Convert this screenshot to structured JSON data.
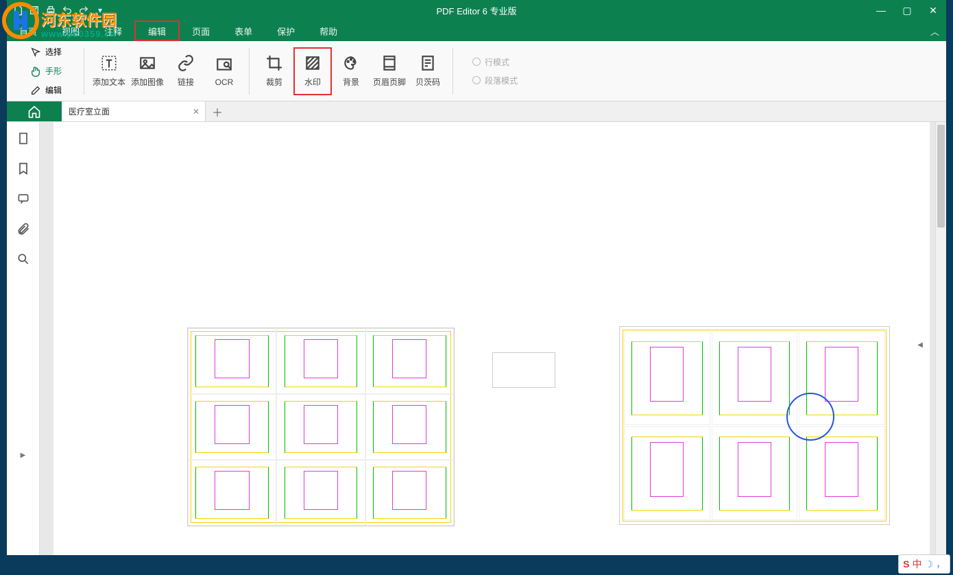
{
  "app_title": "PDF Editor 6 专业版",
  "watermark": {
    "brand": "河东软件园",
    "url": "www.pc0359.cn"
  },
  "menus": {
    "home": "首页",
    "view": "视图",
    "comment": "注释",
    "edit": "编辑",
    "page": "页面",
    "form": "表单",
    "protect": "保护",
    "help": "帮助"
  },
  "tools_left": {
    "select": "选择",
    "hand": "手形",
    "edit": "编辑"
  },
  "ribbon": {
    "add_text": "添加文本",
    "add_image": "添加图像",
    "link": "链接",
    "ocr": "OCR",
    "crop": "裁剪",
    "watermark": "水印",
    "background": "背景",
    "header_footer": "页眉页脚",
    "bates": "贝茨码"
  },
  "mode": {
    "line": "行模式",
    "paragraph": "段落模式"
  },
  "tab": {
    "doc_name": "医疗室立面"
  },
  "tray": {
    "ime": "中"
  }
}
